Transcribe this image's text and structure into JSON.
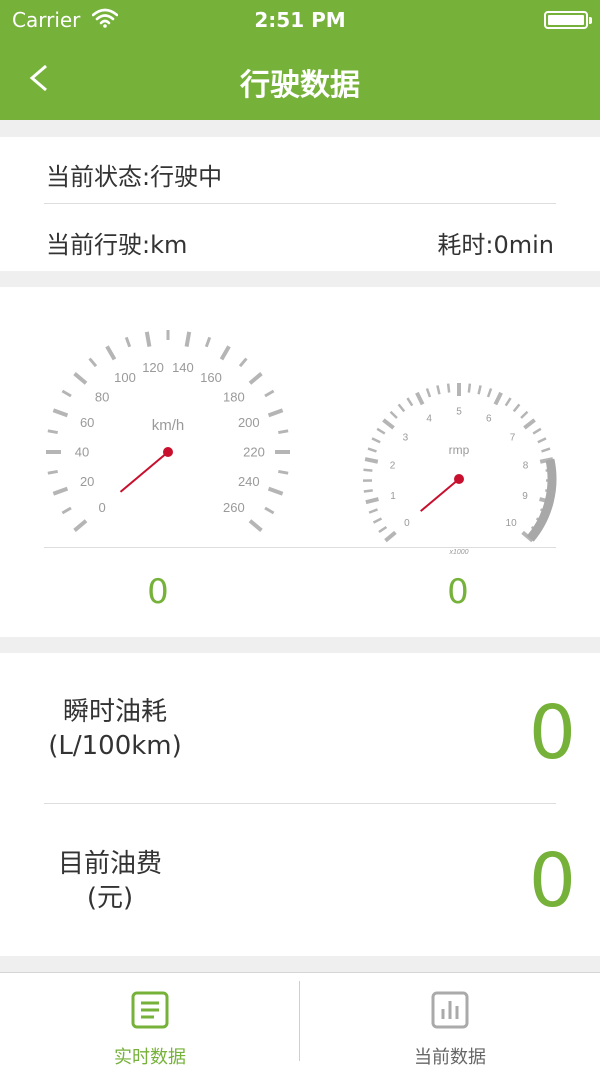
{
  "status_bar": {
    "carrier": "Carrier",
    "time": "2:51 PM"
  },
  "nav": {
    "title": "行驶数据",
    "back_icon": "chevron-left-icon"
  },
  "trip": {
    "state": "当前状态:行驶中",
    "distance": "当前行驶:km",
    "duration": "耗时:0min"
  },
  "speedometer": {
    "unit": "km/h",
    "labels": [
      "0",
      "20",
      "40",
      "60",
      "80",
      "100",
      "120",
      "140",
      "160",
      "180",
      "200",
      "220",
      "240",
      "260"
    ],
    "value": 0,
    "display": "0"
  },
  "tachometer": {
    "unit": "rmp",
    "multiplier": "x1000",
    "labels": [
      "0",
      "1",
      "2",
      "3",
      "4",
      "5",
      "6",
      "7",
      "8",
      "9",
      "10"
    ],
    "value": 0,
    "display": "0"
  },
  "fuel": {
    "instant_label_1": "瞬时油耗",
    "instant_label_2": "(L/100km)",
    "instant_value": "0",
    "cost_label_1": "目前油费",
    "cost_label_2": "(元)",
    "cost_value": "0"
  },
  "tabs": [
    {
      "label": "实时数据",
      "icon": "document-list-icon",
      "active": true
    },
    {
      "label": "当前数据",
      "icon": "bar-chart-icon",
      "active": false
    }
  ],
  "colors": {
    "accent": "#76b13a",
    "needle": "#c8102e",
    "gauge_gray": "#b5b5b5"
  }
}
